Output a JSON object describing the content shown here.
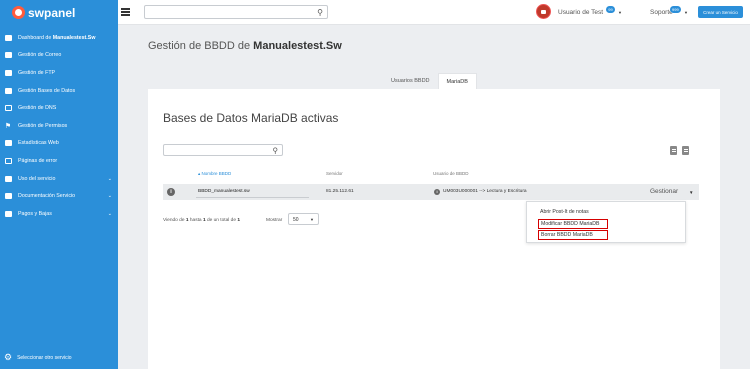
{
  "brand": {
    "name": "swpanel"
  },
  "topbar": {
    "search_placeholder": "",
    "user_label": "Usuario de Test",
    "user_badge": "99",
    "support_label": "Soporte",
    "support_badge": "999",
    "cta_label": "Crear un Servicio"
  },
  "sidebar": {
    "items": [
      {
        "label": "Dashboard de ",
        "bold": "Manualestest.Sw",
        "icon": "dashboard-icon"
      },
      {
        "label": "Gestión de Correo",
        "icon": "mail-icon"
      },
      {
        "label": "Gestión de FTP",
        "icon": "folder-icon"
      },
      {
        "label": "Gestión Bases de Datos",
        "icon": "database-icon"
      },
      {
        "label": "Gestión de DNS",
        "icon": "dns-icon"
      },
      {
        "label": "Gestión de Permisos",
        "icon": "key-icon"
      },
      {
        "label": "Estadísticas Web",
        "icon": "chart-icon"
      },
      {
        "label": "Páginas de error",
        "icon": "page-icon"
      },
      {
        "label": "Uso del servicio",
        "icon": "usage-icon"
      },
      {
        "label": "Documentación Servicio",
        "icon": "docs-icon"
      },
      {
        "label": "Pagos y Bajas",
        "icon": "payments-icon"
      }
    ],
    "footer_label": "Seleccionar otro servicio"
  },
  "main": {
    "title_prefix": "Gestión de BBDD de ",
    "title_bold": "Manualestest.Sw",
    "tabs": [
      {
        "label": "Usuarios BBDD",
        "active": false
      },
      {
        "label": "MariaDB",
        "active": true
      }
    ]
  },
  "card": {
    "title": "Bases de Datos MariaDB activas",
    "search_placeholder": "",
    "columns": [
      "Nombre BBDD",
      "Servidor",
      "Usuario de BBDD"
    ],
    "rows": [
      {
        "name": "BBDD_manualestest.sw",
        "server": "81.25.112.61",
        "user": "UM003U000001 --> Lectura y Escritura",
        "action": "Gestionar"
      }
    ],
    "summary_prefix": "Viendo de ",
    "summary_from": "1",
    "summary_mid1": " hasta ",
    "summary_to": "1",
    "summary_mid2": " de un total de ",
    "summary_total": "1",
    "show_label": "Mostrar",
    "show_value": "50"
  },
  "dropdown": {
    "items": [
      "Abrir Post-It de notas",
      "Modificar BBDD MariaDB",
      "Borrar BBDD MariaDB"
    ]
  },
  "colors": {
    "accent": "#2b8fd9",
    "highlight": "#d50000"
  }
}
